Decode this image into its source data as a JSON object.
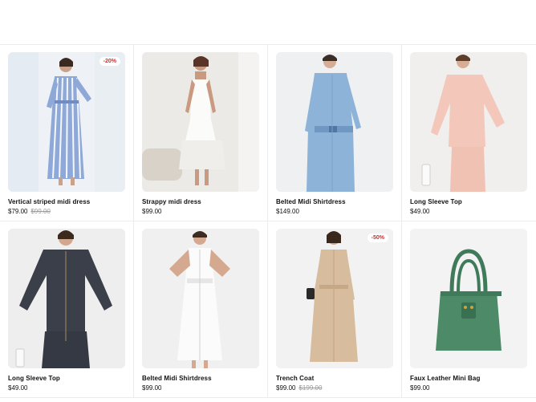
{
  "products": [
    {
      "name": "Vertical striped midi dress",
      "price": "$79.00",
      "old_price": "$99.00",
      "badge": "-20%"
    },
    {
      "name": "Strappy midi dress",
      "price": "$99.00",
      "old_price": "",
      "badge": ""
    },
    {
      "name": "Belted Midi Shirtdress",
      "price": "$149.00",
      "old_price": "",
      "badge": ""
    },
    {
      "name": "Long Sleeve Top",
      "price": "$49.00",
      "old_price": "",
      "badge": ""
    },
    {
      "name": "Long Sleeve Top",
      "price": "$49.00",
      "old_price": "",
      "badge": ""
    },
    {
      "name": "Belted Midi Shirtdress",
      "price": "$99.00",
      "old_price": "",
      "badge": ""
    },
    {
      "name": "Trench Coat",
      "price": "$99.00",
      "old_price": "$199.00",
      "badge": "-50%"
    },
    {
      "name": "Faux Leather Mini Bag",
      "price": "$99.00",
      "old_price": "",
      "badge": ""
    }
  ],
  "colors": {
    "sale": "#e0242a",
    "muted": "#9a9a9a",
    "border": "#ececec"
  }
}
